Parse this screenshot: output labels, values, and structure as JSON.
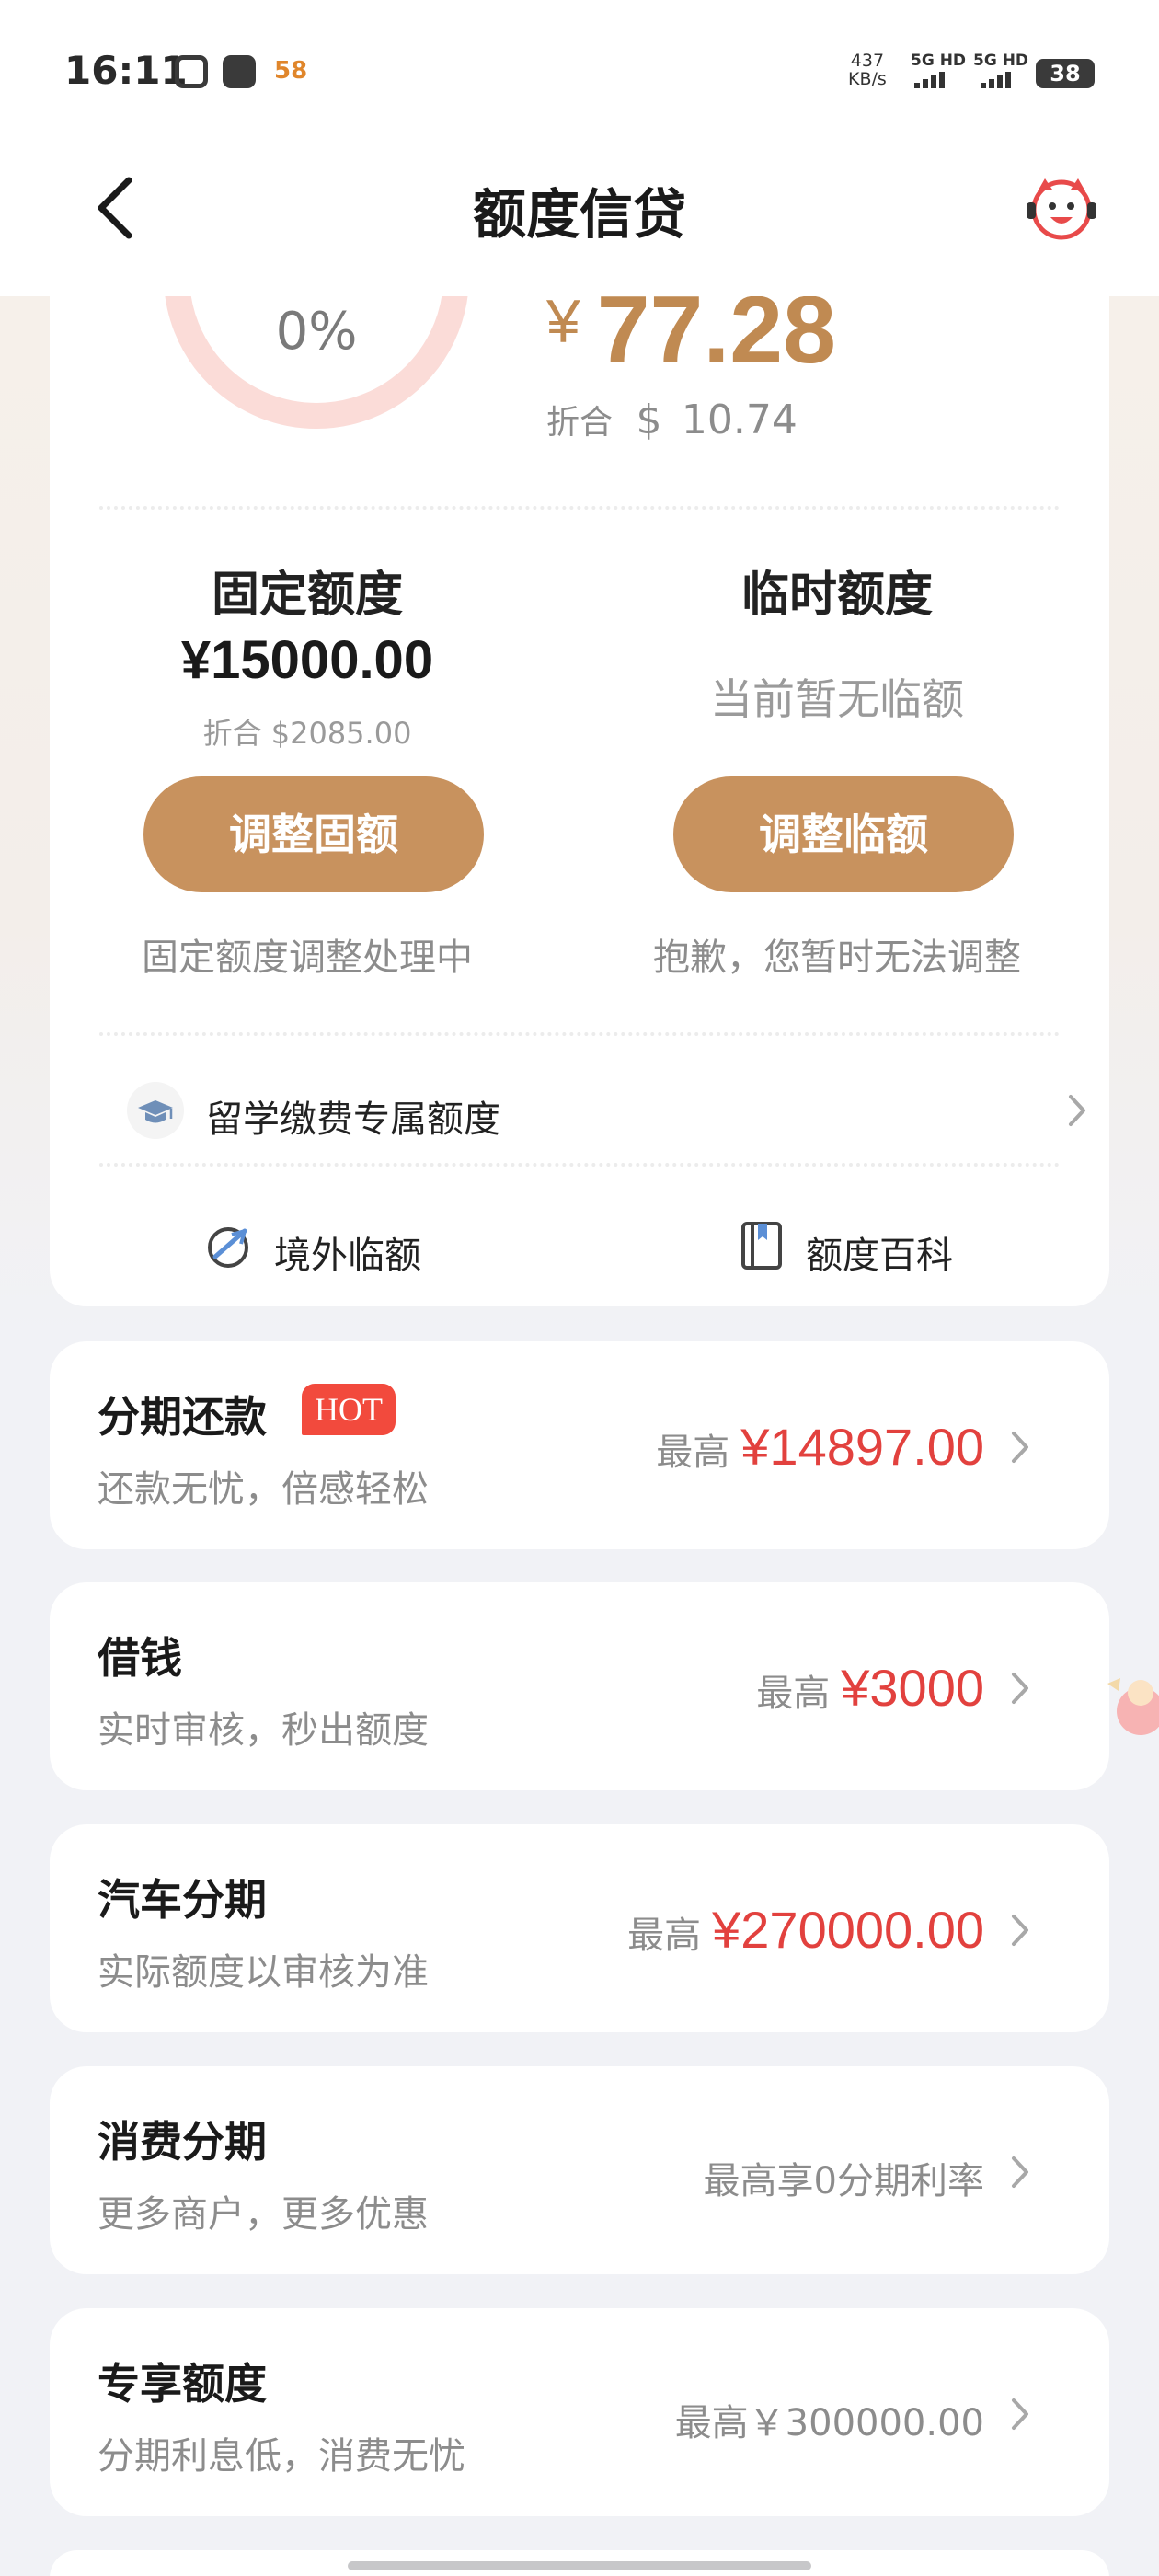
{
  "status_bar": {
    "time": "16:11",
    "net_speed_value": "437",
    "net_speed_unit": "KB/s",
    "sim1": "5G HD",
    "sim2": "5G HD",
    "battery": "38",
    "app_badge": "58"
  },
  "header": {
    "title": "额度信贷"
  },
  "summary": {
    "progress_percent": "0%",
    "currency_symbol": "¥",
    "amount": "77.28",
    "converted_prefix": "折合",
    "converted_currency": "$",
    "converted_amount": "10.74",
    "ring_fraction": 0
  },
  "fixed": {
    "title": "固定额度",
    "amount": "¥15000.00",
    "converted": "折合 $2085.00",
    "button": "调整固额",
    "note": "固定额度调整处理中"
  },
  "temporary": {
    "title": "临时额度",
    "status": "当前暂无临额",
    "button": "调整临额",
    "note": "抱歉，您暂时无法调整"
  },
  "study_row": {
    "label": "留学缴费专属额度"
  },
  "quick_links": [
    {
      "label": "境外临额"
    },
    {
      "label": "额度百科"
    }
  ],
  "products": [
    {
      "title": "分期还款",
      "badge": "HOT",
      "subtitle": "还款无忧，倍感轻松",
      "prefix": "最高",
      "value": "¥14897.00"
    },
    {
      "title": "借钱",
      "subtitle": "实时审核，秒出额度",
      "prefix": "最高",
      "value": "¥3000"
    },
    {
      "title": "汽车分期",
      "subtitle": "实际额度以审核为准",
      "prefix": "最高",
      "value": "¥270000.00"
    },
    {
      "title": "消费分期",
      "subtitle": "更多商户，更多优惠",
      "plain": "最高享0分期利率"
    },
    {
      "title": "专享额度",
      "subtitle": "分期利息低，消费无忧",
      "plain": "最高￥300000.00"
    }
  ],
  "colors": {
    "accent_gold": "#c8925e",
    "amount_gold": "#c08a52",
    "price_red": "#e2413e",
    "hot_badge": "#f24a3d",
    "ring": "#fbdcd8"
  }
}
